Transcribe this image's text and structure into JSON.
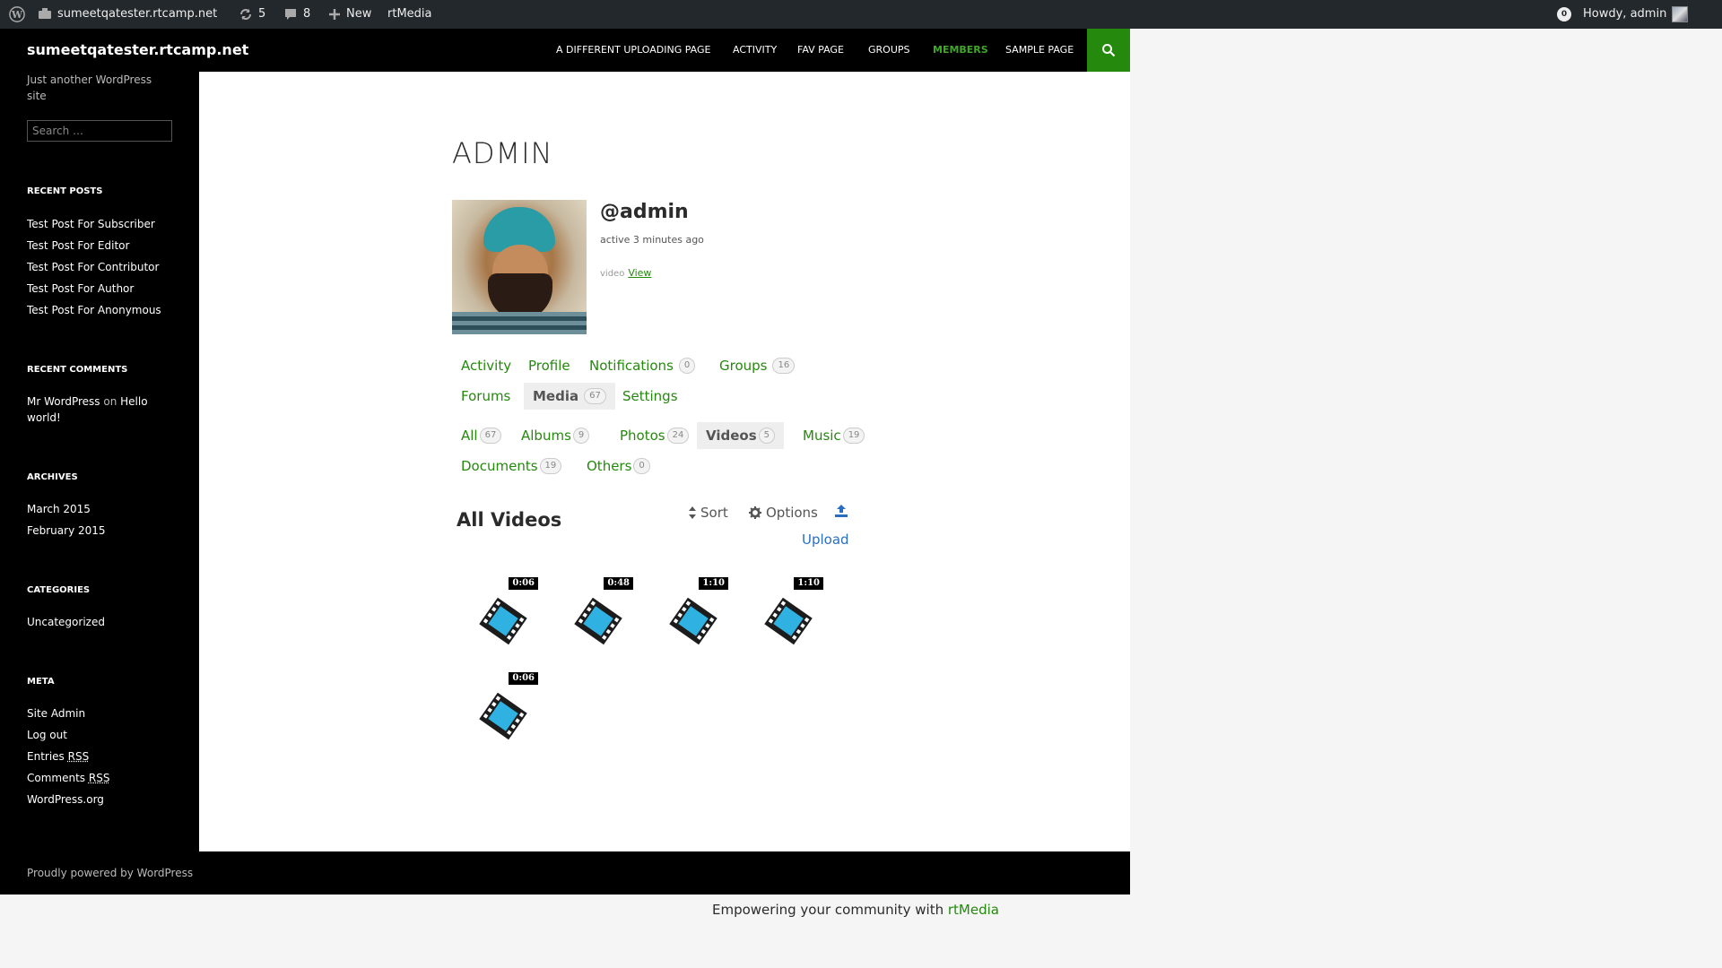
{
  "adminbar": {
    "site": "sumeetqatester.rtcamp.net",
    "updates": "5",
    "comments": "8",
    "new_label": "New",
    "rtmedia_label": "rtMedia",
    "notif_count": "0",
    "howdy": "Howdy, admin"
  },
  "header": {
    "site_title": "sumeetqatester.rtcamp.net",
    "nav": [
      "A DIFFERENT UPLOADING PAGE",
      "ACTIVITY",
      "FAV PAGE",
      "GROUPS",
      "MEMBERS",
      "SAMPLE PAGE"
    ],
    "current_nav": "MEMBERS"
  },
  "sidebar": {
    "tagline": "Just another WordPress site",
    "search_placeholder": "Search …",
    "recent_posts_title": "RECENT POSTS",
    "recent_posts": [
      "Test Post For Subscriber",
      "Test Post For Editor",
      "Test Post For Contributor",
      "Test Post For Author",
      "Test Post For Anonymous"
    ],
    "recent_comments_title": "RECENT COMMENTS",
    "comment_author": "Mr WordPress",
    "comment_on": "on",
    "comment_post": "Hello world!",
    "archives_title": "ARCHIVES",
    "archives": [
      "March 2015",
      "February 2015"
    ],
    "categories_title": "CATEGORIES",
    "categories": [
      "Uncategorized"
    ],
    "meta_title": "META",
    "meta": {
      "site_admin": "Site Admin",
      "log_out": "Log out",
      "entries": "Entries",
      "comments": "Comments",
      "rss": "RSS",
      "wordpress_org": "WordPress.org"
    }
  },
  "profile": {
    "page_title": "ADMIN",
    "mention": "@admin",
    "last_active": "active 3 minutes ago",
    "latest_update_text": "video",
    "latest_update_link": "View"
  },
  "nav_tabs": {
    "activity": "Activity",
    "profile": "Profile",
    "notifications": "Notifications",
    "notifications_count": "0",
    "groups": "Groups",
    "groups_count": "16",
    "forums": "Forums",
    "media": "Media",
    "media_count": "67",
    "settings": "Settings"
  },
  "media_tabs": {
    "all": "All",
    "all_count": "67",
    "albums": "Albums",
    "albums_count": "9",
    "photos": "Photos",
    "photos_count": "24",
    "videos": "Videos",
    "videos_count": "5",
    "music": "Music",
    "music_count": "19",
    "documents": "Documents",
    "documents_count": "19",
    "others": "Others",
    "others_count": "0"
  },
  "gallery": {
    "title": "All Videos",
    "sort_label": "Sort",
    "options_label": "Options",
    "upload_label": "Upload",
    "durations": [
      "0:06",
      "0:48",
      "1:10",
      "1:10",
      "0:06"
    ]
  },
  "footer": {
    "credit": "Proudly powered by WordPress",
    "empower_text": "Empowering your community with",
    "empower_link": "rtMedia"
  }
}
